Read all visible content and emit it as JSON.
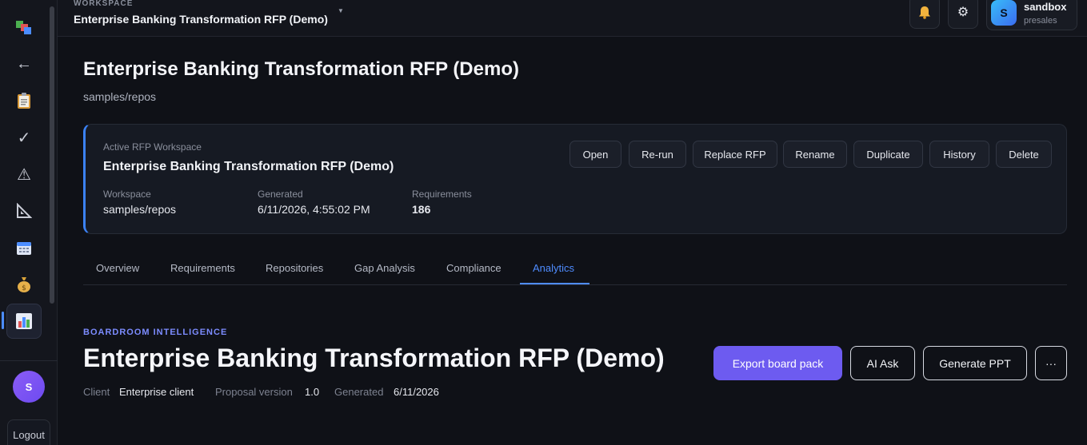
{
  "sidebar": {
    "icons": [
      "app-logo-icon",
      "back-arrow-icon",
      "clipboard-icon",
      "checkmark-icon",
      "warning-icon",
      "ruler-triangle-icon",
      "calendar-icon",
      "money-bag-icon",
      "bar-chart-icon"
    ],
    "avatar_initial": "S",
    "logout_label": "Logout"
  },
  "topbar": {
    "workspace_label": "WORKSPACE",
    "workspace_name": "Enterprise Banking Transformation RFP (Demo)",
    "user_initial": "S",
    "user_name": "sandbox",
    "user_role": "presales"
  },
  "page": {
    "title": "Enterprise Banking Transformation RFP (Demo)",
    "subtitle": "samples/repos"
  },
  "card": {
    "label": "Active RFP Workspace",
    "title": "Enterprise Banking Transformation RFP (Demo)",
    "meta": [
      {
        "key": "Workspace",
        "value": "samples/repos"
      },
      {
        "key": "Generated",
        "value": "6/11/2026, 4:55:02 PM"
      },
      {
        "key": "Requirements",
        "value": "186"
      }
    ],
    "actions": [
      "Open",
      "Re-run",
      "Replace RFP",
      "Rename",
      "Duplicate",
      "History",
      "Delete"
    ]
  },
  "tabs": [
    "Overview",
    "Requirements",
    "Repositories",
    "Gap Analysis",
    "Compliance",
    "Analytics"
  ],
  "active_tab": "Analytics",
  "hero": {
    "eyebrow": "BOARDROOM INTELLIGENCE",
    "title": "Enterprise Banking Transformation RFP (Demo)",
    "client_label": "Client",
    "client_value": "Enterprise client",
    "version_label": "Proposal version",
    "version_value": "1.0",
    "generated_label": "Generated",
    "generated_value": "6/11/2026",
    "buttons": {
      "export": "Export board pack",
      "ask": "AI Ask",
      "ppt": "Generate PPT",
      "more": "···"
    }
  },
  "colors": {
    "accent": "#4f8cff",
    "primary_button": "#6d5bf0",
    "background": "#0f1117"
  }
}
